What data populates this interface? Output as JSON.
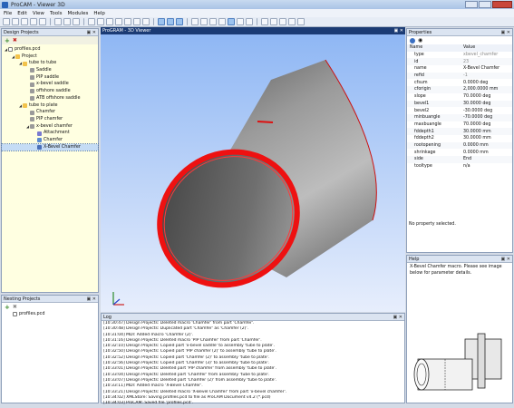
{
  "window": {
    "title": "ProCAM - Viewer 3D"
  },
  "menu": [
    "File",
    "Edit",
    "View",
    "Tools",
    "Modules",
    "Help"
  ],
  "design_projects": {
    "title": "Design Projects",
    "rows": [
      {
        "depth": 0,
        "label": "profiles.pcd",
        "icon": "file",
        "expanded": true
      },
      {
        "depth": 1,
        "label": "Project",
        "icon": "folder",
        "expanded": true
      },
      {
        "depth": 2,
        "label": "tube to tube",
        "icon": "folder",
        "expanded": true
      },
      {
        "depth": 3,
        "label": "Saddle",
        "icon": "part"
      },
      {
        "depth": 3,
        "label": "PIP saddle",
        "icon": "part"
      },
      {
        "depth": 3,
        "label": "x-bevel saddle",
        "icon": "part"
      },
      {
        "depth": 3,
        "label": "offshore saddle",
        "icon": "part"
      },
      {
        "depth": 3,
        "label": "ATB offshore saddle",
        "icon": "part"
      },
      {
        "depth": 2,
        "label": "tube to plate",
        "icon": "folder",
        "expanded": true
      },
      {
        "depth": 3,
        "label": "Chamfer",
        "icon": "part"
      },
      {
        "depth": 3,
        "label": "PIP chamfer",
        "icon": "part"
      },
      {
        "depth": 3,
        "label": "x-bevel chamfer",
        "icon": "part",
        "expanded": true
      },
      {
        "depth": 4,
        "label": "Attachment",
        "icon": "attach"
      },
      {
        "depth": 4,
        "label": "Chamfer",
        "icon": "chamfer"
      },
      {
        "depth": 4,
        "label": "X-Bevel Chamfer",
        "icon": "xbevel",
        "selected": true
      }
    ]
  },
  "nesting_projects": {
    "title": "Nesting Projects",
    "rows": [
      {
        "label": "profiles.pcd"
      }
    ]
  },
  "viewer": {
    "title": "ProGRAM - 3D Viewer"
  },
  "properties": {
    "title": "Properties",
    "col_name": "Name",
    "col_value": "Value",
    "rows": [
      {
        "name": "type",
        "value": "xbevel_chamfer",
        "muted": true
      },
      {
        "name": "id",
        "value": "23",
        "muted": true
      },
      {
        "name": "name",
        "value": "X-Bevel Chamfer"
      },
      {
        "name": "refid",
        "value": "-1",
        "muted": true
      },
      {
        "name": "cfsum",
        "value": "0.0000 deg"
      },
      {
        "name": "cforigin",
        "value": "2,000.0000 mm"
      },
      {
        "name": "slope",
        "value": "70.0000 deg"
      },
      {
        "name": "bevel1",
        "value": "30.0000 deg"
      },
      {
        "name": "bevel2",
        "value": "-30.0000 deg"
      },
      {
        "name": "minbuangle",
        "value": "-70.0000 deg"
      },
      {
        "name": "maxbuangle",
        "value": "70.0000 deg"
      },
      {
        "name": "fddepth1",
        "value": "30.0000 mm"
      },
      {
        "name": "fddepth2",
        "value": "30.0000 mm"
      },
      {
        "name": "rootopening",
        "value": "0.0000 mm"
      },
      {
        "name": "shrinkage",
        "value": "0.0000 mm"
      },
      {
        "name": "side",
        "value": "End"
      },
      {
        "name": "tooltype",
        "value": "n/a"
      }
    ],
    "status": "No property selected."
  },
  "help": {
    "title": "Help",
    "text": "X-Bevel Chamfer macro. Please see image below for parameter details."
  },
  "log": {
    "title": "Log",
    "lines": [
      "[10:30:47] Design Projects: Deleted macro 'Chamfer' from part 'Chamfer'.",
      "[10:30:48] Design Projects: Duplicated part 'Chamfer' as 'Chamfer (2)'.",
      "[10:31:04] MDI: Added macro 'Chamfer (2)'.",
      "[10:31:16] Design Projects: Deleted macro 'PIP Chamfer' from part 'Chamfer'.",
      "[10:32:10] Design Projects: Copied part 'x-bevel saddle' to assembly 'tube to plate'.",
      "[10:32:50] Design Projects: Copied part 'PIP chamfer (2)' to assembly 'tube to plate'.",
      "[10:32:52] Design Projects: Copied part 'Chamfer (2)' to assembly 'tube to plate'.",
      "[10:32:56] Design Projects: Copied part 'Chamfer (3)' to assembly 'tube to plate'.",
      "[10:33:01] Design Projects: Deleted part 'PIP chamfer' from assembly 'tube to plate'.",
      "[10:33:04] Design Projects: Deleted part 'Chamfer' from assembly 'tube to plate'.",
      "[10:33:07] Design Projects: Deleted part 'Chamfer (2)' from assembly 'tube to plate'.",
      "[10:33:11] MDI: Added macro 'X-Bevel Chamfer'.",
      "[10:33:21] Design Projects: Deleted macro 'X-Bevel Chamfer' from part 'x-bevel chamfer'.",
      "[10:34:02] XMLStore: Saving profiles.pcd to file as ProCAM Document v4.2 (*.pcd)",
      "[10:34:03] ProCAM: Saved file 'profiles.pcd'."
    ]
  }
}
